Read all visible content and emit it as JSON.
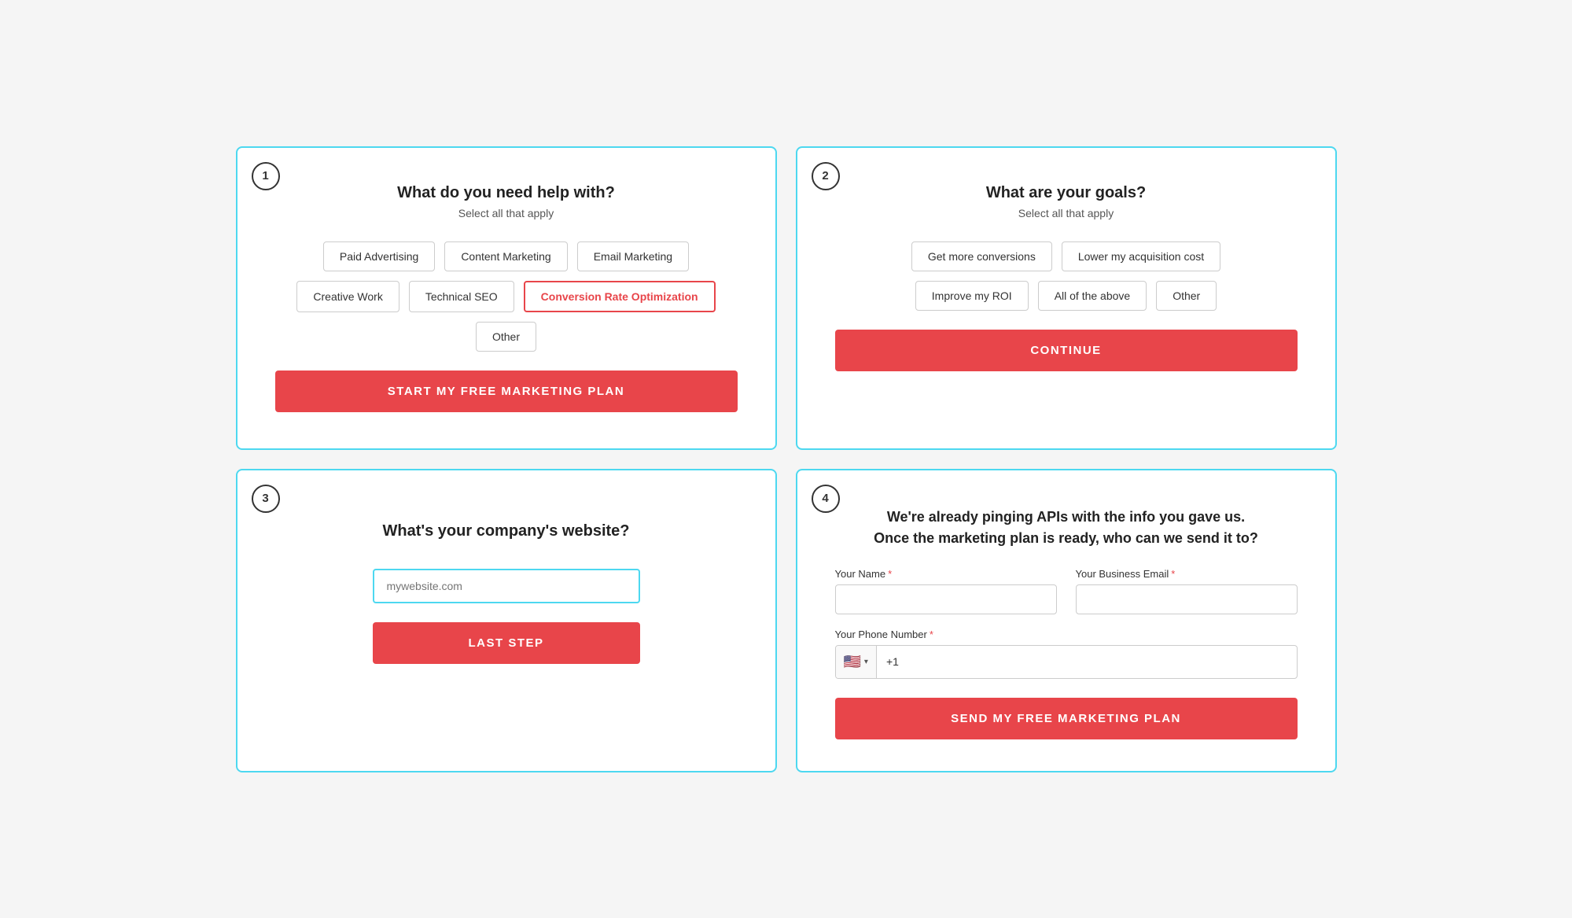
{
  "card1": {
    "step": "1",
    "title": "What do you need help with?",
    "subtitle": "Select all that apply",
    "options_row1": [
      {
        "label": "Paid Advertising",
        "selected": false
      },
      {
        "label": "Content Marketing",
        "selected": false
      },
      {
        "label": "Email Marketing",
        "selected": false
      }
    ],
    "options_row2": [
      {
        "label": "Creative Work",
        "selected": false
      },
      {
        "label": "Technical SEO",
        "selected": false
      },
      {
        "label": "Conversion Rate Optimization",
        "selected": true
      }
    ],
    "options_row3": [
      {
        "label": "Other",
        "selected": false
      }
    ],
    "cta_label": "START MY FREE MARKETING PLAN"
  },
  "card2": {
    "step": "2",
    "title": "What are your goals?",
    "subtitle": "Select all that apply",
    "options_row1": [
      {
        "label": "Get more conversions",
        "selected": false
      },
      {
        "label": "Lower my acquisition cost",
        "selected": false
      }
    ],
    "options_row2": [
      {
        "label": "Improve my ROI",
        "selected": false
      },
      {
        "label": "All of the above",
        "selected": false
      },
      {
        "label": "Other",
        "selected": false
      }
    ],
    "cta_label": "CONTINUE"
  },
  "card3": {
    "step": "3",
    "title": "What's your company's website?",
    "input_placeholder": "mywebsite.com",
    "cta_label": "LAST STEP"
  },
  "card4": {
    "step": "4",
    "header_line1": "We're already pinging APIs with the info you gave us.",
    "header_line2": "Once the marketing plan is ready, who can we send it to?",
    "name_label": "Your Name",
    "email_label": "Your Business Email",
    "phone_label": "Your Phone Number",
    "phone_prefix": "+1",
    "flag_emoji": "🇺🇸",
    "cta_label": "SEND MY FREE MARKETING PLAN"
  }
}
